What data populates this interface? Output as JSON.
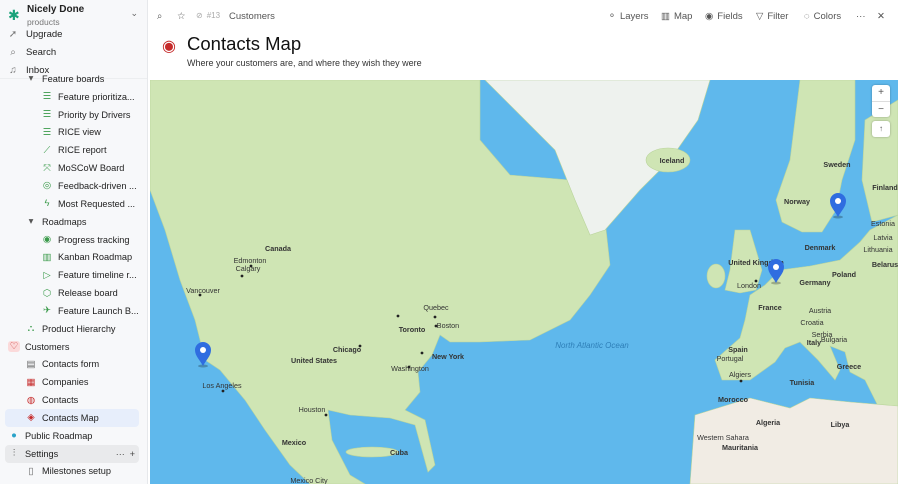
{
  "workspace": {
    "name": "Nicely Done",
    "subtitle": "products"
  },
  "top_nav": [
    {
      "label": "Upgrade",
      "icon": "rocket-icon"
    },
    {
      "label": "Search",
      "icon": "search-icon"
    },
    {
      "label": "Inbox",
      "icon": "bell-icon"
    }
  ],
  "tree": [
    {
      "label": "Feature boards",
      "level": 1,
      "icon": "caret-down-icon",
      "glyph": "▾",
      "color": "#555"
    },
    {
      "label": "Feature prioritiza...",
      "level": 2,
      "icon": "numbered-list-icon",
      "glyph": "☰",
      "color": "#3a9a4a"
    },
    {
      "label": "Priority by Drivers",
      "level": 2,
      "icon": "numbered-list-icon",
      "glyph": "☰",
      "color": "#3a9a4a"
    },
    {
      "label": "RICE view",
      "level": 2,
      "icon": "numbered-list-icon",
      "glyph": "☰",
      "color": "#3a9a4a"
    },
    {
      "label": "RICE report",
      "level": 2,
      "icon": "line-chart-icon",
      "glyph": "⟋",
      "color": "#3a9a4a"
    },
    {
      "label": "MoSCoW Board",
      "level": 2,
      "icon": "expand-arrows-icon",
      "glyph": "⤧",
      "color": "#3a9a4a"
    },
    {
      "label": "Feedback-driven ...",
      "level": 2,
      "icon": "chat-bubble-icon",
      "glyph": "◎",
      "color": "#3a9a4a"
    },
    {
      "label": "Most Requested ...",
      "level": 2,
      "icon": "lightning-icon",
      "glyph": "ϟ",
      "color": "#3a9a4a"
    },
    {
      "label": "Roadmaps",
      "level": 1,
      "icon": "caret-down-icon",
      "glyph": "▾",
      "color": "#555"
    },
    {
      "label": "Progress tracking",
      "level": 2,
      "icon": "eye-icon",
      "glyph": "◉",
      "color": "#3a9a4a"
    },
    {
      "label": "Kanban Roadmap",
      "level": 2,
      "icon": "map-icon",
      "glyph": "▥",
      "color": "#3a9a4a"
    },
    {
      "label": "Feature timeline r...",
      "level": 2,
      "icon": "timeline-icon",
      "glyph": "▷",
      "color": "#3a9a4a"
    },
    {
      "label": "Release board",
      "level": 2,
      "icon": "package-icon",
      "glyph": "⬡",
      "color": "#3a9a4a"
    },
    {
      "label": "Feature Launch B...",
      "level": 2,
      "icon": "rocket-icon",
      "glyph": "✈",
      "color": "#3a9a4a"
    },
    {
      "label": "Product Hierarchy",
      "level": 1,
      "icon": "hierarchy-icon",
      "glyph": "⛬",
      "color": "#3a9a4a"
    },
    {
      "label": "Customers",
      "level": 0,
      "icon": "heart-icon",
      "glyph": "♡",
      "color": "#c62b2b"
    },
    {
      "label": "Contacts form",
      "level": 1,
      "icon": "form-icon",
      "glyph": "▤",
      "color": "#666"
    },
    {
      "label": "Companies",
      "level": 1,
      "icon": "building-icon",
      "glyph": "▦",
      "color": "#c62b2b"
    },
    {
      "label": "Contacts",
      "level": 1,
      "icon": "user-circle-icon",
      "glyph": "◍",
      "color": "#c62b2b"
    },
    {
      "label": "Contacts Map",
      "level": 1,
      "icon": "map-pin-icon",
      "glyph": "◈",
      "color": "#c62b2b",
      "selected": true
    },
    {
      "label": "Public Roadmap",
      "level": 0,
      "icon": "globe-icon",
      "glyph": "●",
      "color": "#2aa3c9"
    },
    {
      "label": "Settings",
      "level": 0,
      "icon": "sliders-icon",
      "glyph": "⫶",
      "color": "#666",
      "settings": true
    },
    {
      "label": "Milestones setup",
      "level": 1,
      "icon": "mobile-icon",
      "glyph": "▯",
      "color": "#666"
    }
  ],
  "settings_actions": {
    "more": "···",
    "add": "+"
  },
  "toolbar": {
    "record_id": "#13",
    "breadcrumb": "Customers",
    "layers": "Layers",
    "map": "Map",
    "fields": "Fields",
    "filter": "Filter",
    "colors": "Colors",
    "more": "···",
    "close": "✕"
  },
  "page": {
    "title": "Contacts Map",
    "subtitle": "Where your customers are, and where they wish they were"
  },
  "map": {
    "zoom_in": "+",
    "zoom_out": "−",
    "compass": "↑",
    "labels": [
      "Iceland",
      "Sweden",
      "Finland",
      "Norway",
      "Estonia",
      "Latvia",
      "Lithuania",
      "Denmark",
      "Belarus",
      "United Kingdom",
      "London",
      "Poland",
      "Germany",
      "France",
      "Austria",
      "Croatia",
      "Serbia",
      "Bulgaria",
      "Italy",
      "Spain",
      "Portugal",
      "Greece",
      "Algiers",
      "Tunisia",
      "Morocco",
      "Algeria",
      "Libya",
      "Western Sahara",
      "Mauritania",
      "Canada",
      "Edmonton",
      "Calgary",
      "Vancouver",
      "Quebec",
      "Toronto",
      "Boston",
      "Chicago",
      "New York",
      "Washington",
      "United States",
      "Los Angeles",
      "Houston",
      "Mexico",
      "Cuba",
      "Mexico City",
      "North Atlantic Ocean"
    ],
    "pins": 3,
    "colors": {
      "ocean": "#5fb8ec",
      "land": "#cfe5b4",
      "desert": "#f1ece4",
      "pin": "#2f6de0"
    }
  }
}
